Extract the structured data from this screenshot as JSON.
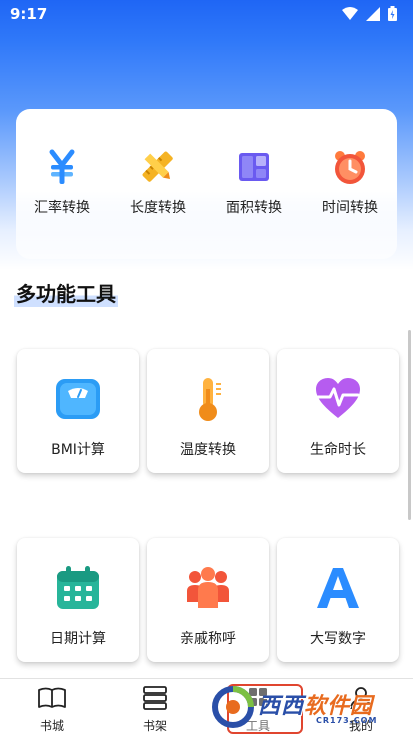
{
  "status_bar": {
    "time": "9:17"
  },
  "converters": [
    {
      "label": "汇率转换",
      "icon": "currency-yen-icon"
    },
    {
      "label": "长度转换",
      "icon": "ruler-pencil-icon"
    },
    {
      "label": "面积转换",
      "icon": "area-blocks-icon"
    },
    {
      "label": "时间转换",
      "icon": "alarm-clock-icon"
    }
  ],
  "section": {
    "title": "多功能工具"
  },
  "tools": [
    {
      "label": "BMI计算",
      "icon": "weight-scale-icon"
    },
    {
      "label": "温度转换",
      "icon": "thermometer-icon"
    },
    {
      "label": "生命时长",
      "icon": "heart-pulse-icon"
    },
    {
      "label": "日期计算",
      "icon": "calendar-icon"
    },
    {
      "label": "亲戚称呼",
      "icon": "family-people-icon"
    },
    {
      "label": "大写数字",
      "icon": "letter-a-icon"
    }
  ],
  "bottom_nav": [
    {
      "label": "书城",
      "icon": "open-book-icon"
    },
    {
      "label": "书架",
      "icon": "bookshelf-icon"
    },
    {
      "label": "工具",
      "icon": "tools-icon",
      "active": true
    },
    {
      "label": "我的",
      "icon": "profile-icon"
    }
  ],
  "watermark": {
    "text_1": "西西",
    "text_2": "软件园",
    "sub": "CR173.COM"
  },
  "colors": {
    "header_blue": "#2f78f9",
    "accent_blue": "#2b8cff",
    "watermark_red": "#e0452f"
  }
}
